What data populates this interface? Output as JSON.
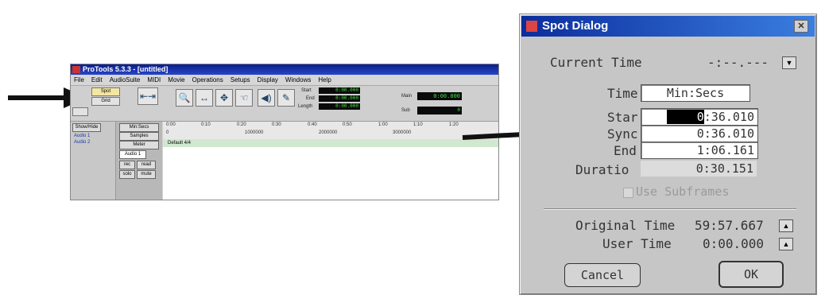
{
  "protools": {
    "title": "ProTools 5.3.3 - [untitled]",
    "menu": [
      "File",
      "Edit",
      "AudioSuite",
      "MIDI",
      "Movie",
      "Operations",
      "Setups",
      "Display",
      "Windows",
      "Help"
    ],
    "modes": [
      "Spot",
      "Grid"
    ],
    "counters": {
      "start_label": "Start",
      "end_label": "End",
      "length_label": "Length",
      "start": "0:00.000",
      "end": "0:00.000",
      "length": "0:00.000",
      "main_label": "Main",
      "main": "0:00.000",
      "sub_label": "Sub",
      "sub": "0"
    },
    "side": {
      "show_hide": "Show/Hide",
      "tracks": [
        "Audio 1",
        "Audio 2"
      ]
    },
    "mixer": {
      "timescale": "Min:Secs",
      "samples": "Samples",
      "meter": "Meter",
      "track": "Audio 1",
      "rec": "rec",
      "read": "read",
      "solo": "solo",
      "mute": "mute"
    },
    "ruler_ticks": [
      "0:00",
      "0:10",
      "0:20",
      "0:30",
      "0:40",
      "0:50",
      "1:00",
      "1:10",
      "1:20"
    ],
    "sample_ticks": [
      "0",
      "1000000",
      "2000000",
      "3000000"
    ],
    "meter_text": "Default 4/4"
  },
  "dialog": {
    "title": "Spot Dialog",
    "current_time_label": "Current Time",
    "current_time_value": "-:--.---",
    "time_label": "Time",
    "time_format": "Min:Secs",
    "start_label": "Star",
    "start_value_hi": "0",
    "start_value": ":36.010",
    "sync_label": "Sync",
    "sync_value": "0:36.010",
    "end_label": "End",
    "end_value": "1:06.161",
    "duration_label": "Duratio",
    "duration_value": "0:30.151",
    "subframes_label": "Use Subframes",
    "original_time_label": "Original Time",
    "original_time_value": "59:57.667",
    "user_time_label": "User Time",
    "user_time_value": "0:00.000",
    "cancel": "Cancel",
    "ok": "OK"
  }
}
